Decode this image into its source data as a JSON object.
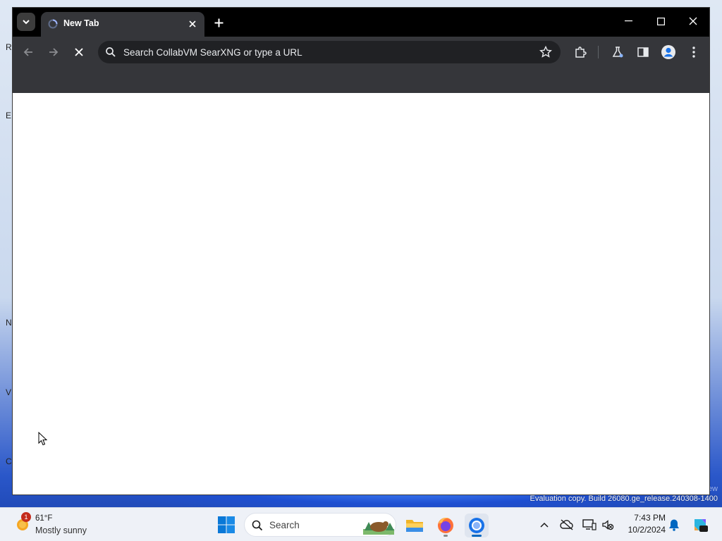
{
  "desktop": {
    "icon_letters": [
      "R",
      "E",
      "N",
      "V",
      "C"
    ],
    "watermark": "Evaluation copy. Build 26080.ge_release.240308-1400",
    "watermark_partial": "iew"
  },
  "browser": {
    "tab": {
      "title": "New Tab"
    },
    "omnibox": {
      "placeholder": "Search CollabVM SearXNG or type a URL"
    }
  },
  "taskbar": {
    "weather": {
      "temp": "61°F",
      "desc": "Mostly sunny",
      "badge": "1"
    },
    "search": {
      "label": "Search"
    },
    "clock": {
      "time": "7:43 PM",
      "date": "10/2/2024"
    }
  },
  "colors": {
    "titlebar": "#000000",
    "toolbar": "#35363a",
    "omnibox": "#202124",
    "accent": "#0067c0"
  }
}
